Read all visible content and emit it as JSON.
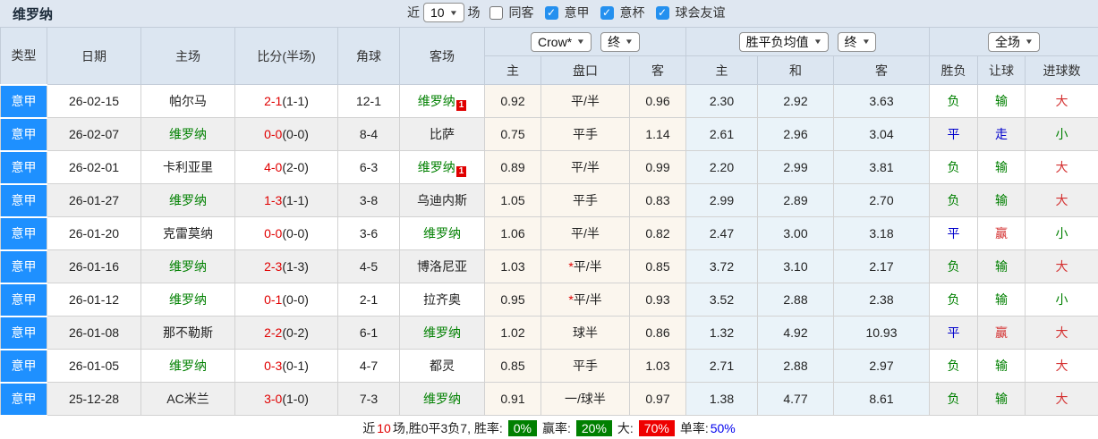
{
  "page": {
    "title": "维罗纳"
  },
  "topbar": {
    "near_label": "近",
    "near_value": "10",
    "games_label": "场",
    "checkboxes": [
      {
        "label": "同客",
        "checked": false
      },
      {
        "label": "意甲",
        "checked": true
      },
      {
        "label": "意杯",
        "checked": true
      },
      {
        "label": "球会友谊",
        "checked": true
      }
    ]
  },
  "controls": {
    "odds_source": "Crow*",
    "odds_time": "终",
    "avg_source": "胜平负均值",
    "avg_time": "终",
    "scope": "全场"
  },
  "table": {
    "columns": [
      "类型",
      "日期",
      "主场",
      "比分(半场)",
      "角球",
      "客场",
      "主",
      "盘口",
      "客",
      "主",
      "和",
      "客",
      "胜负",
      "让球",
      "进球数"
    ],
    "rows": [
      {
        "league": "意甲",
        "date": "26-02-15",
        "home": {
          "name": "帕尔马",
          "hl": false,
          "badge": null
        },
        "score": "2-1",
        "half": "(1-1)",
        "corner": "12-1",
        "away": {
          "name": "维罗纳",
          "hl": true,
          "badge": "1"
        },
        "odds_home": "0.92",
        "handicap": "平/半",
        "handicap_star": false,
        "odds_away": "0.96",
        "avg_win": "2.30",
        "avg_draw": "2.92",
        "avg_lose": "3.63",
        "res_wdl": "负",
        "res_handicap": "输",
        "res_goals": "大"
      },
      {
        "league": "意甲",
        "date": "26-02-07",
        "home": {
          "name": "维罗纳",
          "hl": true,
          "badge": null
        },
        "score": "0-0",
        "half": "(0-0)",
        "corner": "8-4",
        "away": {
          "name": "比萨",
          "hl": false,
          "badge": null
        },
        "odds_home": "0.75",
        "handicap": "平手",
        "handicap_star": false,
        "odds_away": "1.14",
        "avg_win": "2.61",
        "avg_draw": "2.96",
        "avg_lose": "3.04",
        "res_wdl": "平",
        "res_handicap": "走",
        "res_goals": "小"
      },
      {
        "league": "意甲",
        "date": "26-02-01",
        "home": {
          "name": "卡利亚里",
          "hl": false,
          "badge": null
        },
        "score": "4-0",
        "half": "(2-0)",
        "corner": "6-3",
        "away": {
          "name": "维罗纳",
          "hl": true,
          "badge": "1"
        },
        "odds_home": "0.89",
        "handicap": "平/半",
        "handicap_star": false,
        "odds_away": "0.99",
        "avg_win": "2.20",
        "avg_draw": "2.99",
        "avg_lose": "3.81",
        "res_wdl": "负",
        "res_handicap": "输",
        "res_goals": "大"
      },
      {
        "league": "意甲",
        "date": "26-01-27",
        "home": {
          "name": "维罗纳",
          "hl": true,
          "badge": null
        },
        "score": "1-3",
        "half": "(1-1)",
        "corner": "3-8",
        "away": {
          "name": "乌迪内斯",
          "hl": false,
          "badge": null
        },
        "odds_home": "1.05",
        "handicap": "平手",
        "handicap_star": false,
        "odds_away": "0.83",
        "avg_win": "2.99",
        "avg_draw": "2.89",
        "avg_lose": "2.70",
        "res_wdl": "负",
        "res_handicap": "输",
        "res_goals": "大"
      },
      {
        "league": "意甲",
        "date": "26-01-20",
        "home": {
          "name": "克雷莫纳",
          "hl": false,
          "badge": null
        },
        "score": "0-0",
        "half": "(0-0)",
        "corner": "3-6",
        "away": {
          "name": "维罗纳",
          "hl": true,
          "badge": null
        },
        "odds_home": "1.06",
        "handicap": "平/半",
        "handicap_star": false,
        "odds_away": "0.82",
        "avg_win": "2.47",
        "avg_draw": "3.00",
        "avg_lose": "3.18",
        "res_wdl": "平",
        "res_handicap": "赢",
        "res_goals": "小"
      },
      {
        "league": "意甲",
        "date": "26-01-16",
        "home": {
          "name": "维罗纳",
          "hl": true,
          "badge": null
        },
        "score": "2-3",
        "half": "(1-3)",
        "corner": "4-5",
        "away": {
          "name": "博洛尼亚",
          "hl": false,
          "badge": null
        },
        "odds_home": "1.03",
        "handicap": "平/半",
        "handicap_star": true,
        "odds_away": "0.85",
        "avg_win": "3.72",
        "avg_draw": "3.10",
        "avg_lose": "2.17",
        "res_wdl": "负",
        "res_handicap": "输",
        "res_goals": "大"
      },
      {
        "league": "意甲",
        "date": "26-01-12",
        "home": {
          "name": "维罗纳",
          "hl": true,
          "badge": null
        },
        "score": "0-1",
        "half": "(0-0)",
        "corner": "2-1",
        "away": {
          "name": "拉齐奥",
          "hl": false,
          "badge": null
        },
        "odds_home": "0.95",
        "handicap": "平/半",
        "handicap_star": true,
        "odds_away": "0.93",
        "avg_win": "3.52",
        "avg_draw": "2.88",
        "avg_lose": "2.38",
        "res_wdl": "负",
        "res_handicap": "输",
        "res_goals": "小"
      },
      {
        "league": "意甲",
        "date": "26-01-08",
        "home": {
          "name": "那不勒斯",
          "hl": false,
          "badge": null
        },
        "score": "2-2",
        "half": "(0-2)",
        "corner": "6-1",
        "away": {
          "name": "维罗纳",
          "hl": true,
          "badge": null
        },
        "odds_home": "1.02",
        "handicap": "球半",
        "handicap_star": false,
        "odds_away": "0.86",
        "avg_win": "1.32",
        "avg_draw": "4.92",
        "avg_lose": "10.93",
        "res_wdl": "平",
        "res_handicap": "赢",
        "res_goals": "大"
      },
      {
        "league": "意甲",
        "date": "26-01-05",
        "home": {
          "name": "维罗纳",
          "hl": true,
          "badge": null
        },
        "score": "0-3",
        "half": "(0-1)",
        "corner": "4-7",
        "away": {
          "name": "都灵",
          "hl": false,
          "badge": null
        },
        "odds_home": "0.85",
        "handicap": "平手",
        "handicap_star": false,
        "odds_away": "1.03",
        "avg_win": "2.71",
        "avg_draw": "2.88",
        "avg_lose": "2.97",
        "res_wdl": "负",
        "res_handicap": "输",
        "res_goals": "大"
      },
      {
        "league": "意甲",
        "date": "25-12-28",
        "home": {
          "name": "AC米兰",
          "hl": false,
          "badge": null
        },
        "score": "3-0",
        "half": "(1-0)",
        "corner": "7-3",
        "away": {
          "name": "维罗纳",
          "hl": true,
          "badge": null
        },
        "odds_home": "0.91",
        "handicap": "一/球半",
        "handicap_star": false,
        "odds_away": "0.97",
        "avg_win": "1.38",
        "avg_draw": "4.77",
        "avg_lose": "8.61",
        "res_wdl": "负",
        "res_handicap": "输",
        "res_goals": "大"
      }
    ]
  },
  "footer": {
    "near_label": "近",
    "near_count": "10",
    "summary": "场,胜0平3负7, 胜率:",
    "win_rate": "0%",
    "win_pct_label": "赢率:",
    "win_pct": "20%",
    "big_label": "大:",
    "big_pct": "70%",
    "single_label": "单率:",
    "single_pct": "50%"
  }
}
